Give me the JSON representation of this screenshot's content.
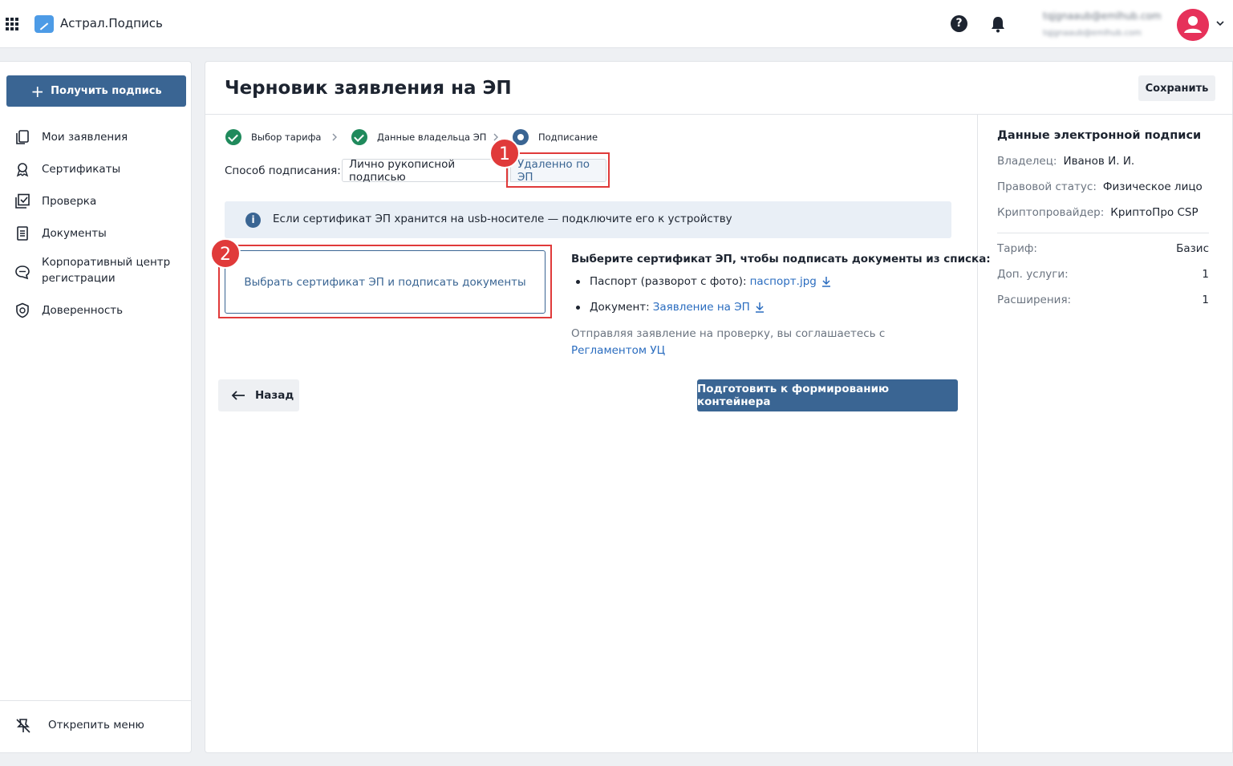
{
  "header": {
    "app_name": "Астрал.Подпись",
    "user_email": "tqjgnaaub@emlhub.com",
    "user_email_secondary": "tqjgnaaub@emlhub.com"
  },
  "sidebar": {
    "get_sign_label": "Получить подпись",
    "items": [
      {
        "label": "Мои заявления",
        "icon": "copy-icon"
      },
      {
        "label": "Сертификаты",
        "icon": "award-icon"
      },
      {
        "label": "Проверка",
        "icon": "check-box-icon"
      },
      {
        "label": "Документы",
        "icon": "document-icon"
      },
      {
        "label": "Корпоративный центр",
        "label2": "регистрации",
        "icon": "chat-icon"
      },
      {
        "label": "Доверенность",
        "icon": "shield-icon"
      }
    ],
    "unpin_label": "Открепить меню"
  },
  "main": {
    "title": "Черновик заявления на ЭП",
    "save_label": "Сохранить",
    "steps": [
      {
        "label": "Выбор тарифа",
        "state": "done"
      },
      {
        "label": "Данные владельца ЭП",
        "state": "done"
      },
      {
        "label": "Подписание",
        "state": "active"
      }
    ],
    "method_label": "Способ подписания:",
    "method_options": [
      "Лично рукописной подписью",
      "Удаленно по ЭП"
    ],
    "info_text": "Если сертификат ЭП хранится на usb-носителе — подключите его к устройству",
    "select_cert_label": "Выбрать сертификат ЭП и подписать документы",
    "instructions_title": "Выберите сертификат ЭП, чтобы подписать документы из списка:",
    "instructions": [
      {
        "label": "Паспорт (разворот с фото):",
        "link": "паспорт.jpg"
      },
      {
        "label": "Документ:",
        "link": "Заявление на ЭП"
      }
    ],
    "consent_text": "Отправляя заявление на проверку, вы соглашаетесь с",
    "consent_link": "Регламентом УЦ",
    "back_label": "Назад",
    "prepare_label": "Подготовить к формированию контейнера"
  },
  "right_panel": {
    "title": "Данные электронной подписи",
    "owner_key": "Владелец:",
    "owner_value": "Иванов И. И.",
    "status_key": "Правовой статус:",
    "status_value": "Физическое лицо",
    "crypto_key": "Криптопровайдер:",
    "crypto_value": "КриптоПро CSP",
    "tariff_key": "Тариф:",
    "tariff_value": "Базис",
    "services_key": "Доп. услуги:",
    "services_value": "1",
    "extensions_key": "Расширения:",
    "extensions_value": "1"
  },
  "annotations": [
    "1",
    "2"
  ],
  "colors": {
    "primary": "#3a6593",
    "success": "#1f8a5c",
    "callout": "#e03a3a",
    "avatar": "#e6315a"
  }
}
